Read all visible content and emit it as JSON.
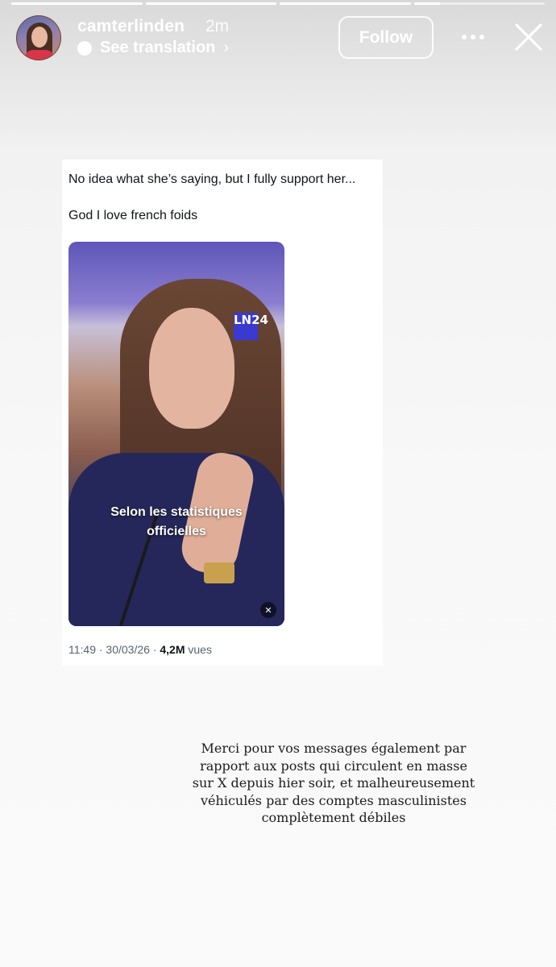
{
  "story": {
    "progress": [
      1.0,
      1.0,
      1.0,
      0.2
    ]
  },
  "header": {
    "username": "camterlinden",
    "time": "2m",
    "see_translation": "See translation",
    "follow_label": "Follow"
  },
  "tweet": {
    "line1": "No idea what she’s saying, but I fully support her...",
    "line2": "God I love french foids",
    "video": {
      "caption_line1": "Selon les statistiques",
      "caption_line2": "officielles",
      "logo": "LN24"
    },
    "meta_time": "11:49 · 30/03/26 · ",
    "meta_views": "4,2M",
    "meta_views_label": " vues"
  },
  "story_text": {
    "lines": [
      "Merci pour vos messages également par",
      "rapport aux posts qui circulent en masse",
      "sur X depuis hier soir, et malheureusement",
      "véhiculés par des comptes masculinistes",
      "complètement débiles"
    ]
  }
}
